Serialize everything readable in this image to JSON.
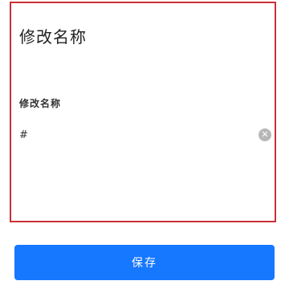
{
  "header": {
    "title": "修改名称"
  },
  "form": {
    "name_label": "修改名称",
    "name_value": "#",
    "clear_icon": "clear-icon"
  },
  "footer": {
    "save_label": "保存"
  },
  "colors": {
    "highlight_border": "#c9303a",
    "primary_button": "#1677ff",
    "clear_icon_bg": "#b7b7b7"
  }
}
